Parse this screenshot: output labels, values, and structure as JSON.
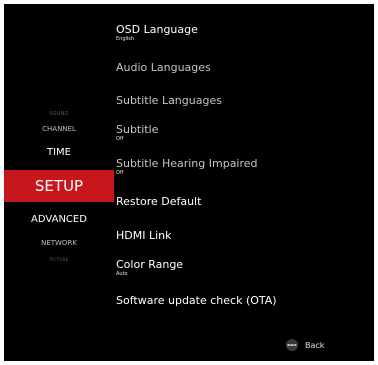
{
  "menu": {
    "categories": [
      {
        "label": "SOUND"
      },
      {
        "label": "CHANNEL"
      },
      {
        "label": "TIME"
      },
      {
        "label": "SETUP",
        "selected": true
      },
      {
        "label": "ADVANCED"
      },
      {
        "label": "NETWORK"
      },
      {
        "label": "PICTURE"
      }
    ],
    "accent_color": "#c7161c"
  },
  "settings": {
    "items": [
      {
        "label": "OSD Language",
        "value": "English"
      },
      {
        "label": "Audio Languages"
      },
      {
        "label": "Subtitle Languages"
      },
      {
        "label": "Subtitle",
        "value": "Off"
      },
      {
        "label": "Subtitle Hearing Impaired",
        "value": "Off"
      },
      {
        "label": "Restore Default"
      },
      {
        "label": "HDMI Link"
      },
      {
        "label": "Color Range",
        "value": "Auto"
      },
      {
        "label": "Software update check (OTA)"
      }
    ]
  },
  "footer": {
    "back_icon_text": "BACK",
    "back_label": "Back"
  }
}
